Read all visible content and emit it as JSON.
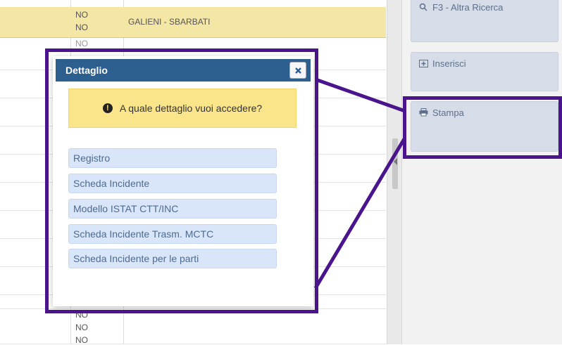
{
  "table": {
    "highlight_row": {
      "col1_line1": "NO",
      "col1_line2": "NO",
      "col2": "GALIENI - SBARBATI"
    },
    "row_partial_top": "NO",
    "bottom_rows": [
      "NO",
      "NO",
      "NO"
    ]
  },
  "right_panel": {
    "buttons": [
      {
        "label": "F3 - Altra Ricerca",
        "icon": "search-icon"
      },
      {
        "label": "Inserisci",
        "icon": "insert-icon"
      },
      {
        "label": "Stampa",
        "icon": "print-icon"
      }
    ]
  },
  "dialog": {
    "title": "Dettaglio",
    "close_icon": "close-icon",
    "message": "A quale dettaglio vuoi accedere?",
    "options": [
      "Registro",
      "Scheda Incidente",
      "Modello ISTAT CTT/INC",
      "Scheda Incidente Trasm. MCTC",
      "Scheda Incidente per le parti"
    ]
  },
  "colors": {
    "annotation": "#4a148c",
    "header": "#2d5f8e",
    "warning_bg": "#fbe58a",
    "option_bg": "#d9e6f9",
    "row_highlight": "#f4e7a6"
  }
}
